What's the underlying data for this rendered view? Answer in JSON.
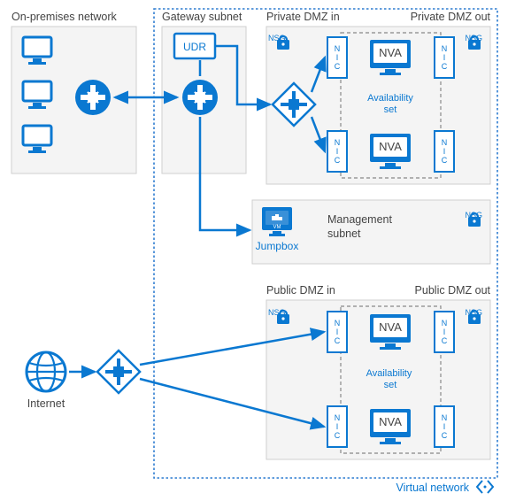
{
  "labels": {
    "onprem": "On-premises network",
    "gateway": "Gateway subnet",
    "private_dmz_in": "Private DMZ in",
    "private_dmz_out": "Private DMZ out",
    "public_dmz_in": "Public DMZ in",
    "public_dmz_out": "Public DMZ out",
    "management": "Management\nsubnet",
    "virtual_network": "Virtual network",
    "internet": "Internet"
  },
  "elements": {
    "udr": "UDR",
    "jumpbox": "Jumpbox",
    "nva": "NVA",
    "availability_set": "Availability\nset",
    "nic": "N\nI\nC",
    "nsg": "NSG"
  },
  "colors": {
    "azure": "#0a78d1",
    "zone_fill": "#f4f4f4",
    "zone_stroke": "#cfcfcf",
    "dash": "#2f7dd1",
    "dash_grey": "#9a9a9a"
  }
}
